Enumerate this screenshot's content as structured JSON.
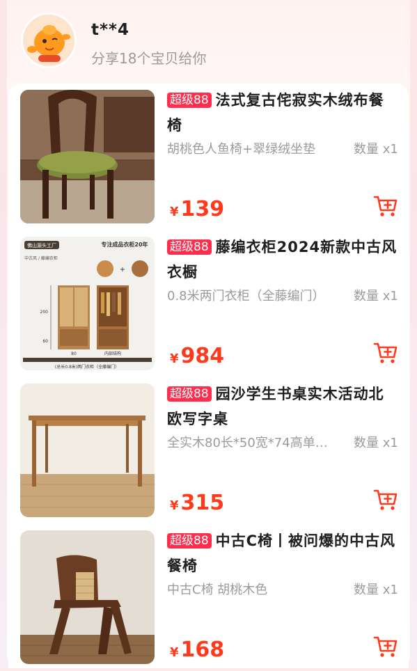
{
  "header": {
    "user_name": "t**4",
    "share_text": "分享18个宝贝给你"
  },
  "colors": {
    "accent": "#ff3a1c",
    "badge": "#ff2e4d",
    "cart": "#ff3a1c"
  },
  "items": [
    {
      "badge": "超级88",
      "title": "法式复古侘寂实木绒布餐椅",
      "spec": "胡桃色人鱼椅+翠绿绒坐垫",
      "qty": "数量 x1",
      "currency": "¥",
      "price": "139",
      "image_icon": "chair-green-cushion-photo"
    },
    {
      "badge": "超级88",
      "title": "藤编衣柜2024新款中古风衣橱",
      "spec": "0.8米两门衣柜（全藤编门）",
      "qty": "数量 x1",
      "currency": "¥",
      "price": "984",
      "image_icon": "rattan-wardrobe-photo",
      "image_texts": {
        "brand": "佛山源头工厂",
        "headline": "专注成品衣柜20年",
        "style": "中古风 / 藤编衣柜",
        "height": "200",
        "base": "60",
        "width": "80",
        "interior": "内部结构",
        "caption": "(总长0.8米)两门衣柜（全藤编门）"
      }
    },
    {
      "badge": "超级88",
      "title": "园沙学生书桌实木活动北欧写字桌",
      "spec": "全实木80长*50宽*74高单…",
      "qty": "数量 x1",
      "currency": "¥",
      "price": "315",
      "image_icon": "wooden-desk-photo"
    },
    {
      "badge": "超级88",
      "title": "中古C椅丨被问爆的中古风餐椅",
      "spec": "中古C椅 胡桃木色",
      "qty": "数量 x1",
      "currency": "¥",
      "price": "168",
      "image_icon": "c-chair-photo"
    }
  ]
}
